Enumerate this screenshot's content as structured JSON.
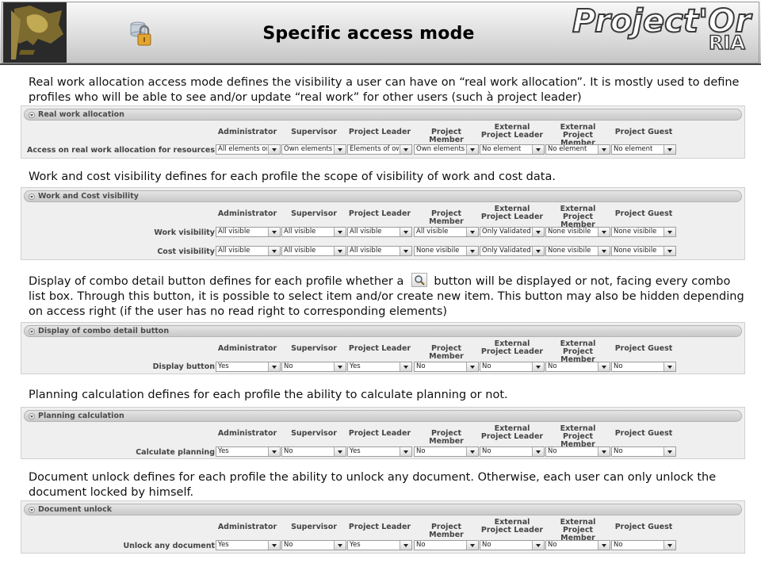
{
  "header": {
    "title": "Specific access mode",
    "brand": "Project'Or",
    "brand_sub": "RIA"
  },
  "columns": [
    "Administrator",
    "Supervisor",
    "Project Leader",
    "Project Member",
    "External\nProject Leader",
    "External\nProject Member",
    "Project Guest"
  ],
  "sections": [
    {
      "description": "Real work allocation access mode defines the visibility a user can have on “real work allocation”. It is mostly used to define profiles who will be able to see and/or update “real work” for other users (such à project leader)",
      "panel_title": "Real work allocation",
      "rows": [
        {
          "label": "Access on real work allocation for resources",
          "values": [
            "All elements on",
            "Own elements",
            "Elements of ow",
            "Own elements",
            "No element",
            "No element",
            "No element"
          ]
        }
      ]
    },
    {
      "description": "Work and cost visibility defines for each profile the scope of visibility of work and cost data.",
      "panel_title": "Work and Cost visibility",
      "rows": [
        {
          "label": "Work visibility",
          "values": [
            "All visible",
            "All visible",
            "All visible",
            "All visible",
            "Only Validated",
            "None visibile",
            "None visibile"
          ]
        },
        {
          "label": "Cost visibility",
          "values": [
            "All visible",
            "All visible",
            "All visible",
            "None visibile",
            "Only Validated",
            "None visibile",
            "None visibile"
          ]
        }
      ]
    },
    {
      "description_before": "Display of combo detail button defines for each profile whether a",
      "description_after": "button will be displayed or not, facing every combo list box. Through this button, it is possible to select item and/or create new item. This button may also be hidden depending on access right (if the user has no read right to corresponding elements)",
      "panel_title": "Display of combo detail button",
      "rows": [
        {
          "label": "Display button",
          "values": [
            "Yes",
            "No",
            "Yes",
            "No",
            "No",
            "No",
            "No"
          ]
        }
      ]
    },
    {
      "description": "Planning calculation defines for each profile the ability to calculate planning or not.",
      "panel_title": "Planning calculation",
      "rows": [
        {
          "label": "Calculate planning",
          "values": [
            "Yes",
            "No",
            "Yes",
            "No",
            "No",
            "No",
            "No"
          ]
        }
      ]
    },
    {
      "description": "Document unlock defines for each profile the ability to unlock any document. Otherwise, each user can only unlock the document locked by himself.",
      "panel_title": "Document unlock",
      "rows": [
        {
          "label": "Unlock any document",
          "values": [
            "Yes",
            "No",
            "Yes",
            "No",
            "No",
            "No",
            "No"
          ]
        }
      ]
    }
  ]
}
